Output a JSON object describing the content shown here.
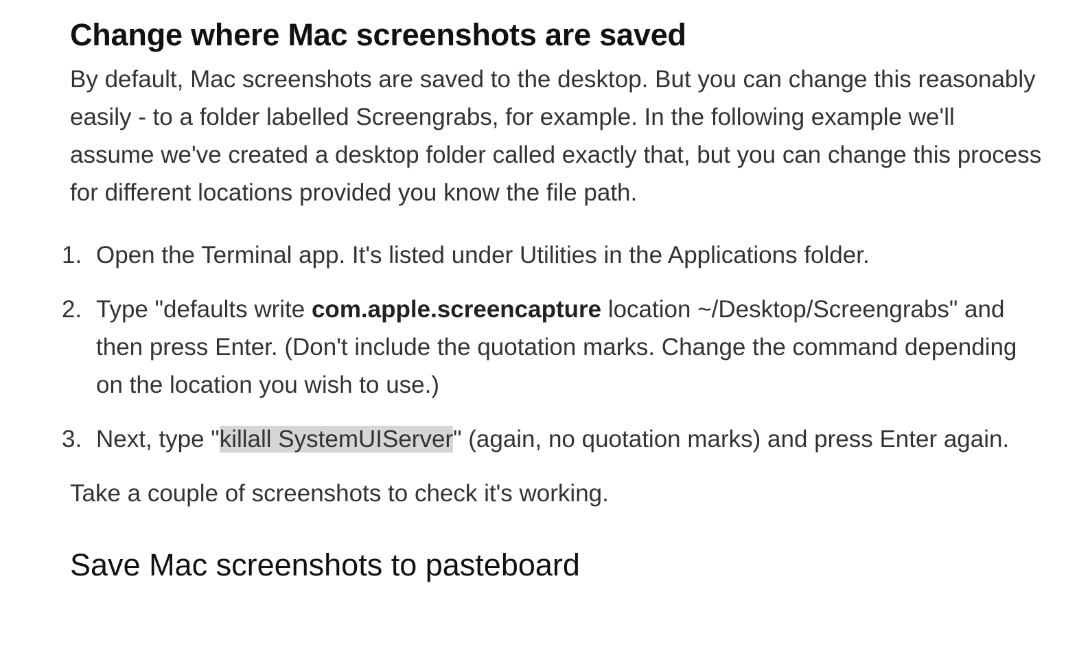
{
  "heading": "Change where Mac screenshots are saved",
  "intro": "By default, Mac screenshots are saved to the desktop. But you can change this reasonably easily - to a folder labelled Screengrabs, for example. In the following example we'll assume we've created a desktop folder called exactly that, but you can change this process for different locations provided you know the file path.",
  "steps": [
    {
      "number": "1.",
      "text": "Open the Terminal app. It's listed under Utilities in the Applications folder."
    },
    {
      "number": "2.",
      "before": "Type \"defaults write ",
      "bold": "com.apple.screencapture",
      "after": " location ~/Desktop/Screengrabs\" and then press Enter. (Don't include the quotation marks. Change the command depending on the location you wish to use.)"
    },
    {
      "number": "3.",
      "before": "Next, type \"",
      "highlighted": "killall SystemUIServer",
      "after": "\" (again, no quotation marks) and press Enter again."
    }
  ],
  "closing": "Take a couple of screenshots to check it's working.",
  "next_heading": "Save Mac screenshots to pasteboard"
}
